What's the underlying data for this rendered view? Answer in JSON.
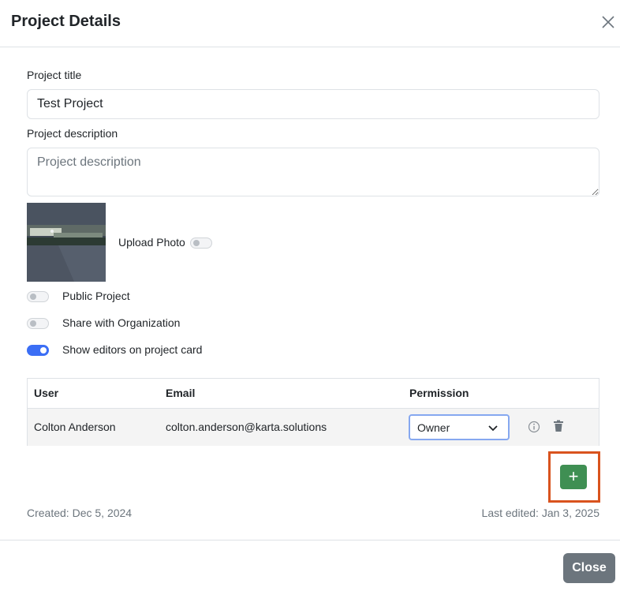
{
  "modal": {
    "title": "Project Details"
  },
  "form": {
    "title_label": "Project title",
    "title_value": "Test Project",
    "description_label": "Project description",
    "description_value": "",
    "description_placeholder": "Project description",
    "upload_photo_label": "Upload Photo",
    "upload_photo_on": false
  },
  "toggles": [
    {
      "label": "Public Project",
      "on": false
    },
    {
      "label": "Share with Organization",
      "on": false
    },
    {
      "label": "Show editors on project card",
      "on": true
    }
  ],
  "users_table": {
    "headers": [
      "User",
      "Email",
      "Permission"
    ],
    "rows": [
      {
        "user": "Colton Anderson",
        "email": "colton.anderson@karta.solutions",
        "permission": "Owner"
      }
    ]
  },
  "footer": {
    "created": "Created: Dec 5, 2024",
    "last_edited": "Last edited: Jan 3, 2025",
    "close_label": "Close",
    "add_label": "+"
  },
  "colors": {
    "toggle_on": "#3b6ef5",
    "add_button": "#3f8f53",
    "highlight": "#d9531e",
    "close_button": "#6c757d"
  },
  "icons": [
    "close-icon",
    "chevron-down-icon",
    "info-icon",
    "trash-icon",
    "plus-icon"
  ]
}
